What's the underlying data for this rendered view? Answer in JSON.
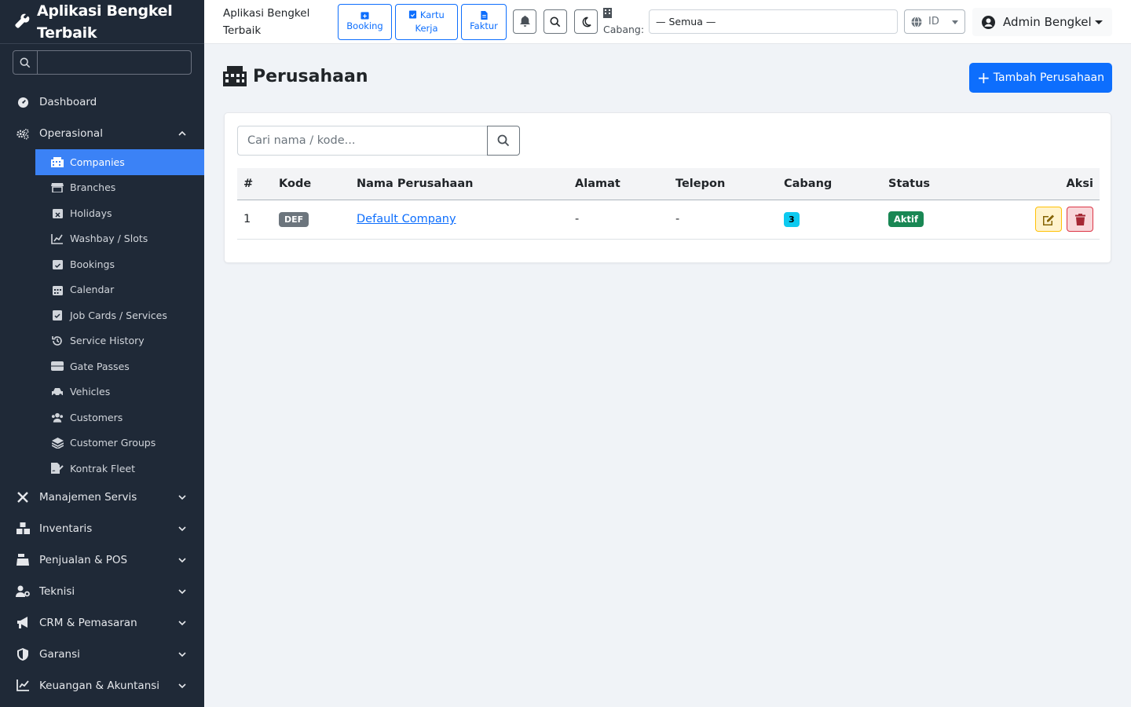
{
  "sidebar": {
    "brand": "Aplikasi Bengkel Terbaik",
    "search_placeholder": "",
    "items": [
      {
        "label": "Dashboard"
      },
      {
        "label": "Operasional"
      },
      {
        "label": "Manajemen Servis"
      },
      {
        "label": "Inventaris"
      },
      {
        "label": "Penjualan & POS"
      },
      {
        "label": "Teknisi"
      },
      {
        "label": "CRM & Pemasaran"
      },
      {
        "label": "Garansi"
      },
      {
        "label": "Keuangan & Akuntansi"
      }
    ],
    "sub_items": [
      {
        "label": "Companies",
        "icon": "building-icon"
      },
      {
        "label": "Branches",
        "icon": "store-icon"
      },
      {
        "label": "Holidays",
        "icon": "calendar-x-icon"
      },
      {
        "label": "Washbay / Slots",
        "icon": "washbay-icon"
      },
      {
        "label": "Bookings",
        "icon": "calendar-check-icon"
      },
      {
        "label": "Calendar",
        "icon": "calendar-icon"
      },
      {
        "label": "Job Cards / Services",
        "icon": "clipboard-check-icon"
      },
      {
        "label": "Service History",
        "icon": "history-icon"
      },
      {
        "label": "Gate Passes",
        "icon": "ticket-icon"
      },
      {
        "label": "Vehicles",
        "icon": "car-icon"
      },
      {
        "label": "Customers",
        "icon": "users-icon"
      },
      {
        "label": "Customer Groups",
        "icon": "layers-icon"
      },
      {
        "label": "Kontrak Fleet",
        "icon": "file-signature-icon"
      }
    ]
  },
  "topbar": {
    "app_title": "Aplikasi Bengkel Terbaik",
    "quick": {
      "booking": "Booking",
      "kartu_kerja": "Kartu Kerja",
      "faktur": "Faktur"
    },
    "cabang_label": "Cabang:",
    "cabang_value": "— Semua —",
    "lang": "ID",
    "user": "Admin Bengkel"
  },
  "page": {
    "title": "Perusahaan",
    "add_button": "Tambah Perusahaan",
    "search_placeholder": "Cari nama / kode..."
  },
  "table": {
    "headers": {
      "no": "#",
      "kode": "Kode",
      "nama": "Nama Perusahaan",
      "alamat": "Alamat",
      "telepon": "Telepon",
      "cabang": "Cabang",
      "status": "Status",
      "aksi": "Aksi"
    },
    "rows": [
      {
        "no": "1",
        "kode": "DEF",
        "nama": "Default Company",
        "alamat": "-",
        "telepon": "-",
        "cabang": "3",
        "status": "Aktif"
      }
    ]
  },
  "colors": {
    "sidebar_bg": "#1f2937",
    "active": "#3b82f6",
    "primary": "#0d6efd",
    "success": "#198754",
    "info": "#0dcaf0"
  }
}
